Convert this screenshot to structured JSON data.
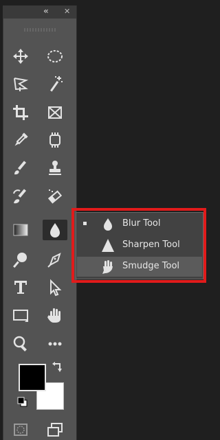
{
  "panel": {
    "collapse_glyph": "«",
    "close_glyph": "✕"
  },
  "tools": [
    {
      "name": "move-tool-icon"
    },
    {
      "name": "elliptical-marquee-tool-icon"
    },
    {
      "name": "polygonal-lasso-tool-icon"
    },
    {
      "name": "magic-wand-tool-icon"
    },
    {
      "name": "crop-tool-icon"
    },
    {
      "name": "frame-tool-icon"
    },
    {
      "name": "eyedropper-tool-icon"
    },
    {
      "name": "spot-healing-brush-tool-icon"
    },
    {
      "name": "brush-tool-icon"
    },
    {
      "name": "clone-stamp-tool-icon"
    },
    {
      "name": "history-brush-tool-icon"
    },
    {
      "name": "eraser-tool-icon"
    },
    {
      "name": "gradient-tool-icon"
    },
    {
      "name": "blur-tool-icon",
      "active": true
    },
    {
      "name": "dodge-tool-icon"
    },
    {
      "name": "pen-tool-icon"
    },
    {
      "name": "type-tool-icon"
    },
    {
      "name": "path-selection-tool-icon"
    },
    {
      "name": "rectangle-tool-icon"
    },
    {
      "name": "hand-tool-icon"
    },
    {
      "name": "zoom-tool-icon"
    },
    {
      "name": "edit-toolbar-icon"
    }
  ],
  "colors": {
    "foreground": "#000000",
    "background": "#ffffff",
    "panel": "#535353",
    "highlight": "#e11b1b"
  },
  "flyout": {
    "items": [
      {
        "label": "Blur Tool",
        "icon": "blur-icon",
        "current": true
      },
      {
        "label": "Sharpen Tool",
        "icon": "sharpen-icon",
        "current": false
      },
      {
        "label": "Smudge Tool",
        "icon": "smudge-icon",
        "current": false,
        "hovered": true
      }
    ]
  }
}
